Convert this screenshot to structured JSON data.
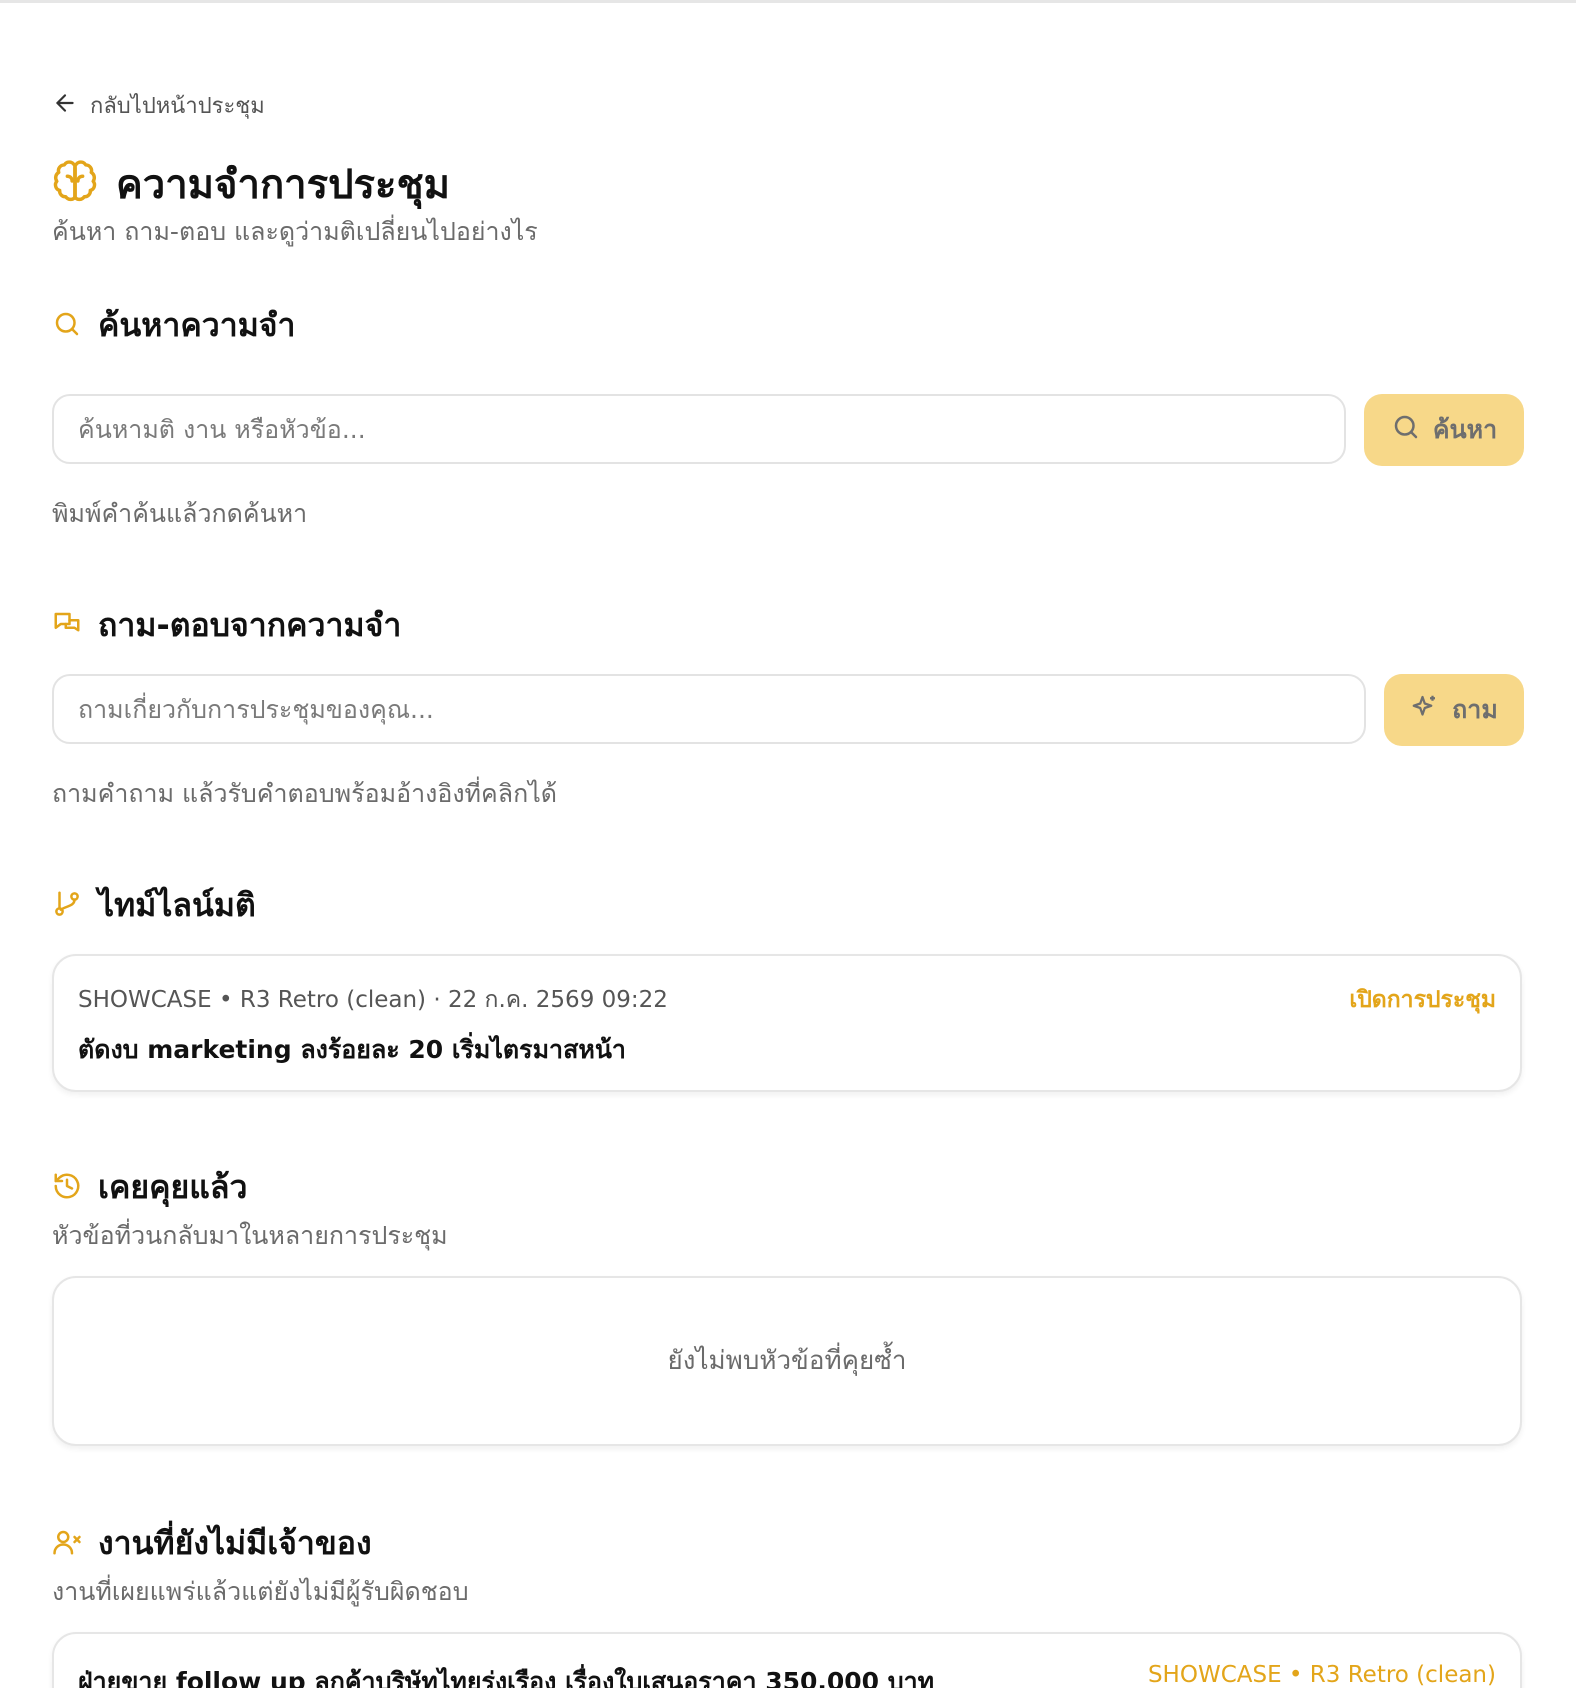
{
  "nav": {
    "back_label": "กลับไปหน้าประชุม"
  },
  "header": {
    "title": "ความจำการประชุม",
    "subtitle": "ค้นหา ถาม-ตอบ และดูว่ามติเปลี่ยนไปอย่างไร"
  },
  "search": {
    "title": "ค้นหาความจำ",
    "placeholder": "ค้นหามติ งาน หรือหัวข้อ...",
    "button_label": "ค้นหา",
    "hint": "พิมพ์คำค้นแล้วกดค้นหา"
  },
  "qa": {
    "title": "ถาม-ตอบจากความจำ",
    "placeholder": "ถามเกี่ยวกับการประชุมของคุณ...",
    "button_label": "ถาม",
    "hint": "ถามคำถาม แล้วรับคำตอบพร้อมอ้างอิงที่คลิกได้"
  },
  "timeline": {
    "title": "ไทม์ไลน์มติ",
    "items": [
      {
        "meta": "SHOWCASE • R3 Retro (clean) · 22 ก.ค. 2569 09:22",
        "link_label": "เปิดการประชุม",
        "text": "ตัดงบ marketing ลงร้อยละ 20 เริ่มไตรมาสหน้า"
      }
    ]
  },
  "recurring": {
    "title": "เคยคุยแล้ว",
    "subtitle": "หัวข้อที่วนกลับมาในหลายการประชุม",
    "empty_text": "ยังไม่พบหัวข้อที่คุยซ้ำ"
  },
  "unowned": {
    "title": "งานที่ยังไม่มีเจ้าของ",
    "subtitle": "งานที่เผยแพร่แล้วแต่ยังไม่มีผู้รับผิดชอบ",
    "items": [
      {
        "text": "ฝ่ายขาย follow up ลูกค้าบริษัทไทยรุ่งเรือง เรื่องใบเสนอราคา 350,000 บาท",
        "meta": "SHOWCASE • R3 Retro (clean)"
      }
    ]
  },
  "colors": {
    "accent": "#e3a51a",
    "button_bg": "#f7d889"
  },
  "icons": {
    "back": "arrow-left-icon",
    "title": "brain-icon",
    "search": "search-icon",
    "qa": "chat-bubbles-icon",
    "ask": "sparkles-icon",
    "timeline": "git-branch-icon",
    "recurring": "history-icon",
    "unowned": "user-x-icon"
  }
}
